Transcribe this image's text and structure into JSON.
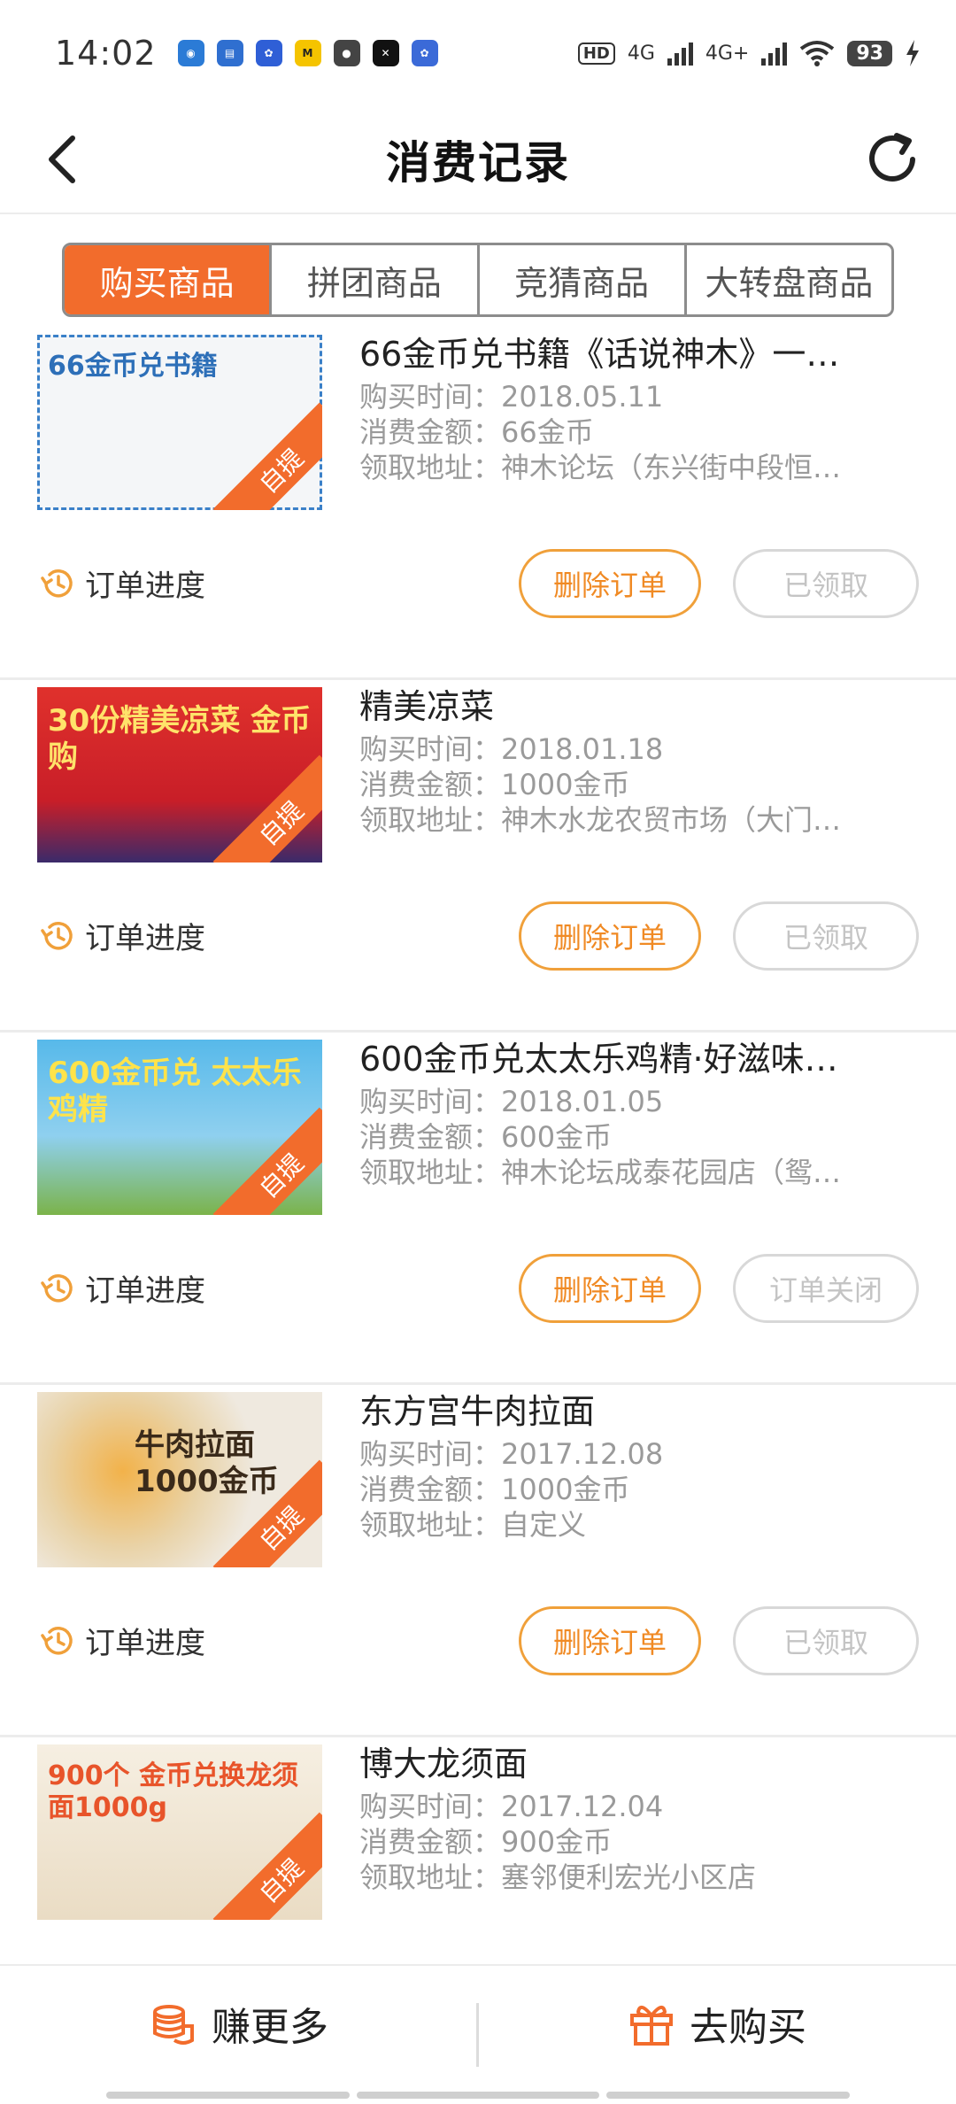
{
  "status_bar": {
    "time": "14:02",
    "network_badge": "HD",
    "network_1": "4G",
    "network_2": "4G+",
    "battery": "93",
    "app_icons": [
      {
        "name": "signal-app-icon",
        "color": "#2b7bd6"
      },
      {
        "name": "news-app-icon",
        "color": "#2f6fd0"
      },
      {
        "name": "baidu-app-icon",
        "color": "#2f5fd6"
      },
      {
        "name": "meituan-app-icon",
        "color": "#f5c400"
      },
      {
        "name": "wechat-app-icon",
        "color": "#444444"
      },
      {
        "name": "capcut-app-icon",
        "color": "#111111"
      },
      {
        "name": "baidu-paw-app-icon",
        "color": "#3b6ad8"
      }
    ]
  },
  "header": {
    "title": "消费记录"
  },
  "tabs": [
    {
      "label": "购买商品",
      "active": true
    },
    {
      "label": "拼团商品",
      "active": false
    },
    {
      "label": "竞猜商品",
      "active": false
    },
    {
      "label": "大转盘商品",
      "active": false
    }
  ],
  "labels": {
    "progress": "订单进度",
    "delete": "删除订单",
    "self_pickup": "自提"
  },
  "orders": [
    {
      "title": "66金币兑书籍《话说神木》一…",
      "purchase_time": "购买时间：2018.05.11",
      "amount": "消费金额：66金币",
      "address": "领取地址：神木论坛（东兴街中段恒…",
      "status": "已领取",
      "thumb_caption": "66金币兑书籍",
      "thumb_bg": "#f4f6f8",
      "thumb_fg": "#2d6fb8"
    },
    {
      "title": "精美凉菜",
      "purchase_time": "购买时间：2018.01.18",
      "amount": "消费金额：1000金币",
      "address": "领取地址：神木水龙农贸市场（大门…",
      "status": "已领取",
      "thumb_caption": "30份精美凉菜 金币购",
      "thumb_bg": "#d7262a",
      "thumb_fg": "#ffe36a"
    },
    {
      "title": "600金币兑太太乐鸡精·好滋味…",
      "purchase_time": "购买时间：2018.01.05",
      "amount": "消费金额：600金币",
      "address": "领取地址：神木论坛成泰花园店（鸳…",
      "status": "订单关闭",
      "thumb_caption": "600金币兑 太太乐鸡精",
      "thumb_bg": "#4fb1e4",
      "thumb_fg": "#ffe34a"
    },
    {
      "title": "东方宫牛肉拉面",
      "purchase_time": "购买时间：2017.12.08",
      "amount": "消费金额：1000金币",
      "address": "领取地址：自定义",
      "status": "已领取",
      "thumb_caption": "牛肉拉面 1000金币",
      "thumb_bg": "#efe9df",
      "thumb_fg": "#3a2a1a"
    },
    {
      "title": "博大龙须面",
      "purchase_time": "购买时间：2017.12.04",
      "amount": "消费金额：900金币",
      "address": "领取地址：塞邻便利宏光小区店",
      "status": "",
      "thumb_caption": "900个 金币兑换龙须面1000g",
      "thumb_bg": "#f3ece0",
      "thumb_fg": "#e8542a"
    }
  ],
  "bottom_bar": {
    "earn": "赚更多",
    "buy": "去购买"
  },
  "colors": {
    "accent": "#f26c2c",
    "button_orange": "#f08a24"
  }
}
